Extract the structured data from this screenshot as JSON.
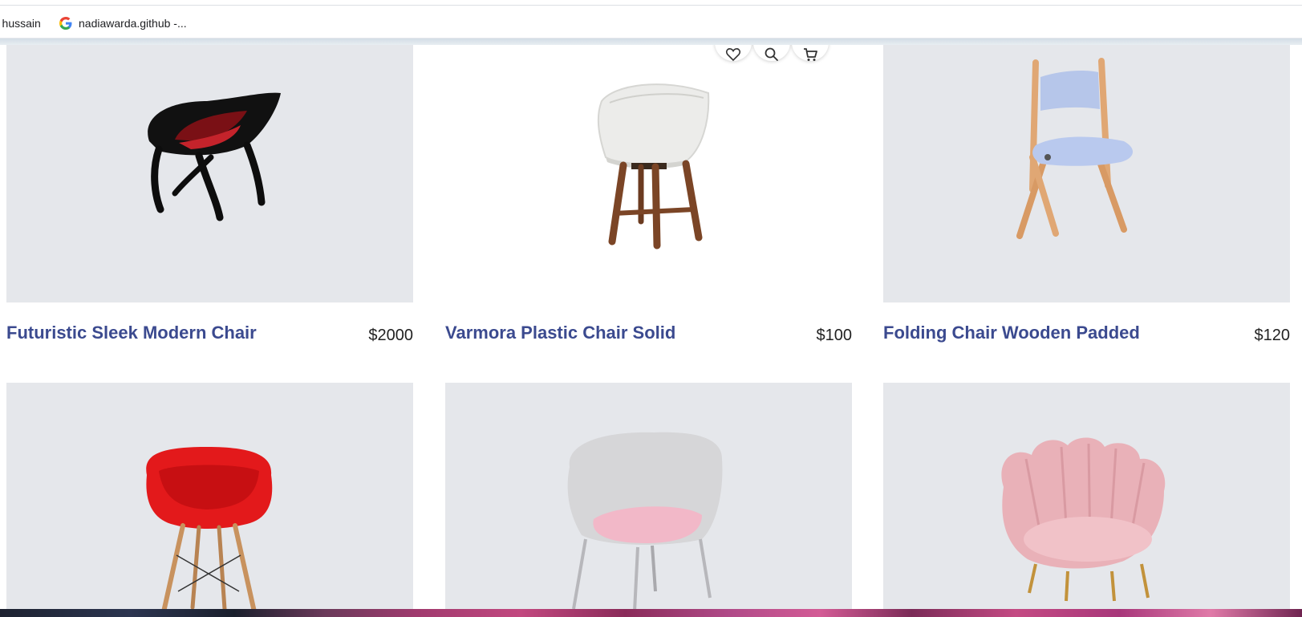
{
  "bookmarks": [
    {
      "label": "r hussain"
    },
    {
      "label": "nadiawarda.github -...",
      "icon": "google-icon"
    }
  ],
  "products": [
    {
      "title": "Futuristic Sleek Modern Chair",
      "price": "$2000",
      "image": "black-red-futuristic-chair"
    },
    {
      "title": "Varmora Plastic Chair Solid",
      "price": "$100",
      "image": "white-plastic-chair-wood-legs"
    },
    {
      "title": "Folding Chair Wooden Padded",
      "price": "$120",
      "image": "wooden-folding-chair-blue-pads"
    },
    {
      "image": "red-eames-chair"
    },
    {
      "image": "grey-pink-upholstered-chair"
    },
    {
      "image": "pink-velvet-shell-chair"
    }
  ],
  "card_actions": [
    "heart-icon",
    "search-icon",
    "cart-icon"
  ],
  "colors": {
    "title": "#3b4a8f",
    "image_bg": "#e5e7eb"
  }
}
